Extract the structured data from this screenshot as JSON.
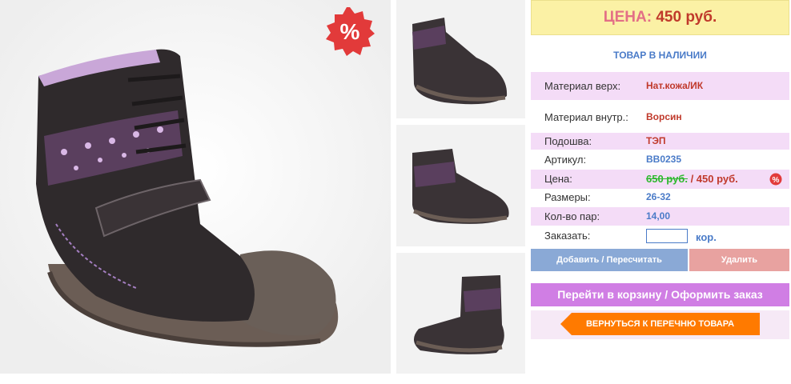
{
  "product": {
    "main_image": "boot-main-photo",
    "sale_badge": "%",
    "thumbnails": [
      "boot-thumb-side",
      "boot-thumb-front",
      "boot-thumb-back"
    ]
  },
  "price_header": {
    "label": "ЦЕНА:",
    "value": "450 руб."
  },
  "stock_status": "ТОВАР В НАЛИЧИИ",
  "specs": [
    {
      "key": "Материал верх:",
      "value": "Нат.кожа/ИК"
    },
    {
      "key": "Материал внутр.:",
      "value": "Ворсин"
    },
    {
      "key": "Подошва:",
      "value": "ТЭП"
    },
    {
      "key": "Артикул:",
      "value": "BB0235"
    },
    {
      "key": "Цена:",
      "old_value": "650 руб.",
      "value": "/ 450 руб."
    },
    {
      "key": "Размеры:",
      "value": "26-32"
    },
    {
      "key": "Кол-во пар:",
      "value": "14,00"
    }
  ],
  "order": {
    "label": "Заказать:",
    "quantity": "",
    "unit": "кор."
  },
  "buttons": {
    "add": "Добавить / Пересчитать",
    "delete": "Удалить",
    "cart": "Перейти в корзину / Оформить заказ",
    "back": "ВЕРНУТЬСЯ К ПЕРЕЧНЮ ТОВАРА"
  },
  "colors": {
    "accent_pink": "#f4dcf7",
    "price_bg": "#fbf1a5",
    "link_blue": "#4a7bc8",
    "price_red": "#c0392b",
    "cart_purple": "#d07ee4",
    "back_orange": "#ff7a00"
  }
}
